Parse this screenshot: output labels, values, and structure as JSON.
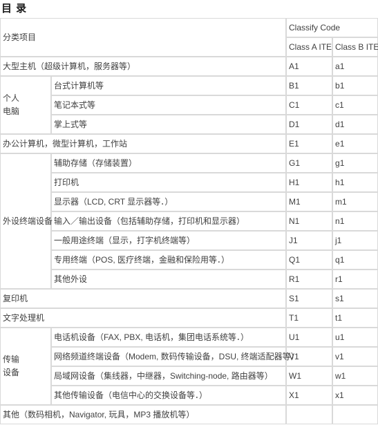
{
  "document": {
    "title": "目  录"
  },
  "table": {
    "header": {
      "category_label": "分类项目",
      "classify_code_label": "Classify Code",
      "class_a_label": "Class A ITE",
      "class_b_label": "Class B ITE"
    },
    "rows": [
      {
        "group": "",
        "group_span": 1,
        "item": "大型主机（超级计算机，服务器等）",
        "item_full_width": true,
        "class_a": "A1",
        "class_b": "a1"
      },
      {
        "group": "个人\n电脑",
        "group_line1": "个人",
        "group_line2": "电脑",
        "group_span": 3,
        "item": "台式计算机等",
        "class_a": "B1",
        "class_b": "b1"
      },
      {
        "item": "笔记本式等",
        "class_a": "C1",
        "class_b": "c1"
      },
      {
        "item": "掌上式等",
        "class_a": "D1",
        "class_b": "d1"
      },
      {
        "group": "",
        "item": "办公计算机，微型计算机，工作站",
        "item_full_width": true,
        "class_a": "E1",
        "class_b": "e1"
      },
      {
        "group_line1": "外设终端设备",
        "group_span": 7,
        "item": "辅助存储（存储装置）",
        "class_a": "G1",
        "class_b": "g1"
      },
      {
        "item": "打印机",
        "class_a": "H1",
        "class_b": "h1"
      },
      {
        "item": "显示器（LCD, CRT 显示器等．）",
        "class_a": "M1",
        "class_b": "m1"
      },
      {
        "item": "输入／输出设备（包括辅助存储，打印机和显示器）",
        "class_a": "N1",
        "class_b": "n1"
      },
      {
        "item": "一般用途终端（显示，打字机终端等）",
        "class_a": "J1",
        "class_b": "j1"
      },
      {
        "item": "专用终端（POS, 医疗终端，金融和保险用等．）",
        "class_a": "Q1",
        "class_b": "q1"
      },
      {
        "item": "其他外设",
        "class_a": "R1",
        "class_b": "r1"
      },
      {
        "item": "复印机",
        "item_full_width": true,
        "class_a": "S1",
        "class_b": "s1"
      },
      {
        "item": "文字处理机",
        "item_full_width": true,
        "class_a": "T1",
        "class_b": "t1"
      },
      {
        "group_line1": "传输",
        "group_line2": "设备",
        "group_span": 4,
        "item": "电话机设备（FAX, PBX, 电话机，集团电话系统等．）",
        "class_a": "U1",
        "class_b": "u1"
      },
      {
        "item": "网络频道终端设备（Modem, 数码传输设备，DSU, 终端适配器等）",
        "class_a": "V1",
        "class_b": "v1"
      },
      {
        "item": "局域网设备（集线器，中继器，Switching-node, 路由器等）",
        "class_a": "W1",
        "class_b": "w1"
      },
      {
        "item": "其他传输设备（电信中心的交换设备等．）",
        "class_a": "X1",
        "class_b": "x1"
      },
      {
        "item": "其他（数码相机，Navigator, 玩具，MP3 播放机等）",
        "item_full_width": true,
        "class_a": "",
        "class_b": ""
      }
    ]
  },
  "colors": {
    "border": "#d9d9d9",
    "text": "#3f3f3f",
    "title_text": "#1a1a1a",
    "background": "#ffffff"
  }
}
